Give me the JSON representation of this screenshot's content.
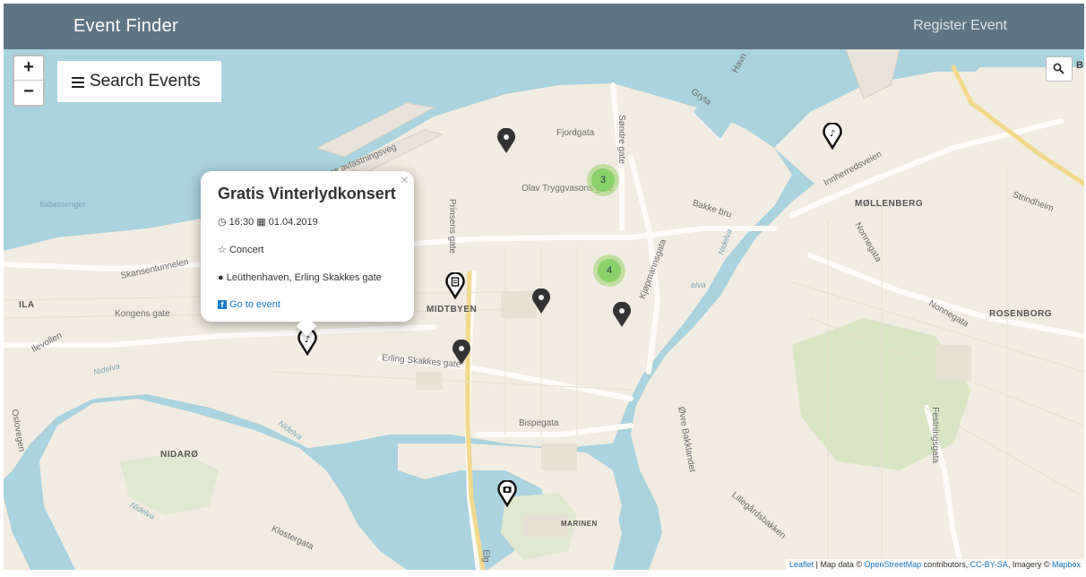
{
  "navbar": {
    "brand": "Event Finder",
    "register": "Register Event"
  },
  "map_controls": {
    "zoom_in": "+",
    "zoom_out": "−",
    "search_events": "Search Events",
    "geo_search_suffix": "B"
  },
  "map_labels": {
    "ilabassenget": "Ilabassenget",
    "skansentunnelen": "Skansentunnelen",
    "ila": "ILA",
    "kongens_gate": "Kongens gate",
    "ilevollen": "Ilevollen",
    "fjordgata": "Fjordgata",
    "sondre_gate": "Søndre gate",
    "olav_tryggvasons_gate": "Olav Tryggvasons gate",
    "bakke_bru": "Bakke bru",
    "prinsens_gate": "Prinsens gate",
    "midtbyen": "MIDTBYEN",
    "erling_skakkes_gate": "Erling Skakkes gate",
    "bispegata": "Bispegata",
    "nidaro": "NIDARØ",
    "nidelva": "Nidelva",
    "klostergata": "Klostergata",
    "marinen": "MARINEN",
    "oslovegen": "Oslovegen",
    "kjopmannsgata": "Kjøpmannsgata",
    "ovre_bakklandet": "Øvre Bakklandet",
    "mollenberg": "MØLLENBERG",
    "innherredsveien": "Innherredsveien",
    "rosenborg": "ROSENBORG",
    "nonnegata": "Nonnegata",
    "festningsgata": "Festningsgata",
    "lillegardsbakken": "Lillegårdsbakken",
    "strindheim": "Strindheim",
    "gryta": "Gryta",
    "havn": "Havn",
    "avlastningsveg": "re avlastningsveg",
    "elva": "elva",
    "eig": "Elg"
  },
  "clusters": [
    {
      "count": "3"
    },
    {
      "count": "4"
    }
  ],
  "popup": {
    "title": "Gratis Vinterlydkonsert",
    "time": "16:30",
    "date": "01.04.2019",
    "category": "Concert",
    "location": "Leüthenhaven, Erling Skakkes gate",
    "link": "Go to event",
    "close": "×"
  },
  "attribution": {
    "leaflet": "Leaflet",
    "sep1": " | Map data © ",
    "osm": "OpenStreetMap",
    "sep2": " contributors, ",
    "license": "CC-BY-SA",
    "sep3": ", Imagery © ",
    "mapbox": "Mapbox"
  },
  "colors": {
    "navbar": "#5e7585",
    "water": "#a9d3df",
    "land": "#f1ece1",
    "park": "#d9e6c4",
    "cluster": "#8bd16a",
    "link": "#1779c7"
  },
  "icons": [
    "music-note-pin-icon",
    "document-pin-icon",
    "camera-pin-icon",
    "event-pin-icon",
    "search-icon",
    "menu-icon",
    "clock-icon",
    "calendar-icon",
    "star-icon",
    "map-marker-icon",
    "facebook-icon"
  ]
}
